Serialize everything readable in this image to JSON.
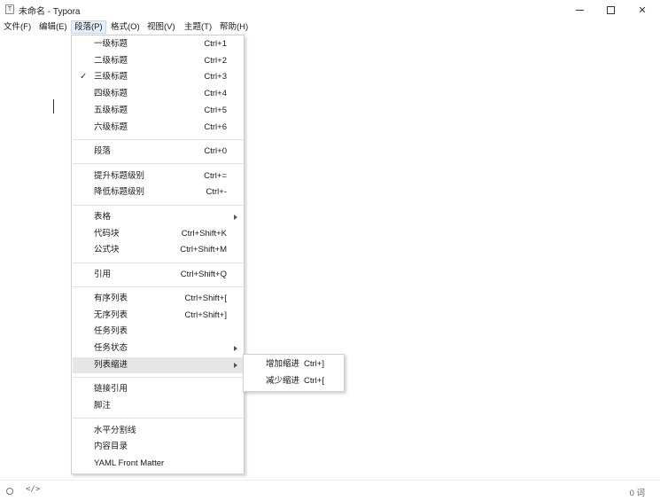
{
  "window": {
    "app_icon": "T",
    "title": "未命名 - Typora",
    "icons": [
      "minimize-icon",
      "maximize-icon",
      "close-icon"
    ],
    "close_glyph": "✕"
  },
  "menubar": {
    "items": [
      {
        "label": "文件(F)"
      },
      {
        "label": "编辑(E)"
      },
      {
        "label": "段落(P)"
      },
      {
        "label": "格式(O)"
      },
      {
        "label": "视图(V)"
      },
      {
        "label": "主题(T)"
      },
      {
        "label": "帮助(H)"
      }
    ],
    "active_index": 2
  },
  "paragraph_menu": {
    "check_glyph": "✓",
    "items": [
      {
        "label": "一级标题",
        "shortcut": "Ctrl+1"
      },
      {
        "label": "二级标题",
        "shortcut": "Ctrl+2"
      },
      {
        "label": "三级标题",
        "shortcut": "Ctrl+3",
        "checked": true
      },
      {
        "label": "四级标题",
        "shortcut": "Ctrl+4"
      },
      {
        "label": "五级标题",
        "shortcut": "Ctrl+5"
      },
      {
        "label": "六级标题",
        "shortcut": "Ctrl+6"
      },
      {
        "label": "段落",
        "shortcut": "Ctrl+0"
      },
      {
        "label": "提升标题级别",
        "shortcut": "Ctrl+="
      },
      {
        "label": "降低标题级别",
        "shortcut": "Ctrl+-"
      },
      {
        "label": "表格",
        "submenu": true
      },
      {
        "label": "代码块",
        "shortcut": "Ctrl+Shift+K"
      },
      {
        "label": "公式块",
        "shortcut": "Ctrl+Shift+M"
      },
      {
        "label": "引用",
        "shortcut": "Ctrl+Shift+Q"
      },
      {
        "label": "有序列表",
        "shortcut": "Ctrl+Shift+["
      },
      {
        "label": "无序列表",
        "shortcut": "Ctrl+Shift+]"
      },
      {
        "label": "任务列表"
      },
      {
        "label": "任务状态",
        "submenu": true
      },
      {
        "label": "列表缩进",
        "submenu": true,
        "hovered": true
      },
      {
        "label": "链接引用"
      },
      {
        "label": "脚注"
      },
      {
        "label": "水平分割线"
      },
      {
        "label": "内容目录"
      },
      {
        "label": "YAML Front Matter"
      }
    ]
  },
  "indent_submenu": {
    "items": [
      {
        "label": "增加缩进",
        "shortcut": "Ctrl+]"
      },
      {
        "label": "减少缩进",
        "shortcut": "Ctrl+["
      }
    ]
  },
  "statusbar": {
    "source_code_glyph": "</>",
    "word_count": "0 词",
    "icons": [
      "outline-circle-icon",
      "source-code-icon"
    ]
  }
}
